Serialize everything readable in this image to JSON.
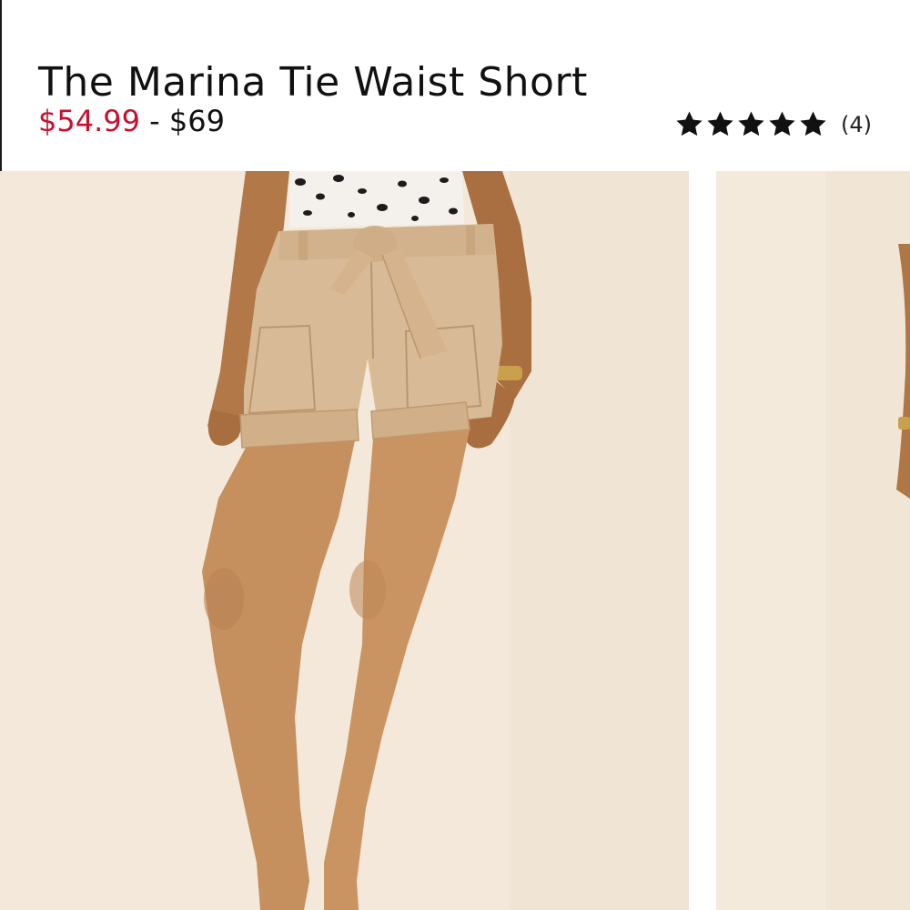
{
  "product": {
    "title": "The Marina Tie Waist Short",
    "sale_price": "$54.99",
    "price_separator": "-",
    "regular_price": "$69",
    "rating": {
      "stars": 5,
      "review_count": "(4)"
    }
  },
  "gallery": {
    "main_image_icon": "product-photo-model-wearing-tan-tie-waist-shorts",
    "next_image_icon": "product-photo-next-partial"
  },
  "colors": {
    "sale_price": "#c8102e",
    "text": "#111111",
    "photo_background": "#f3e8d9",
    "shorts": "#d8bb96"
  }
}
